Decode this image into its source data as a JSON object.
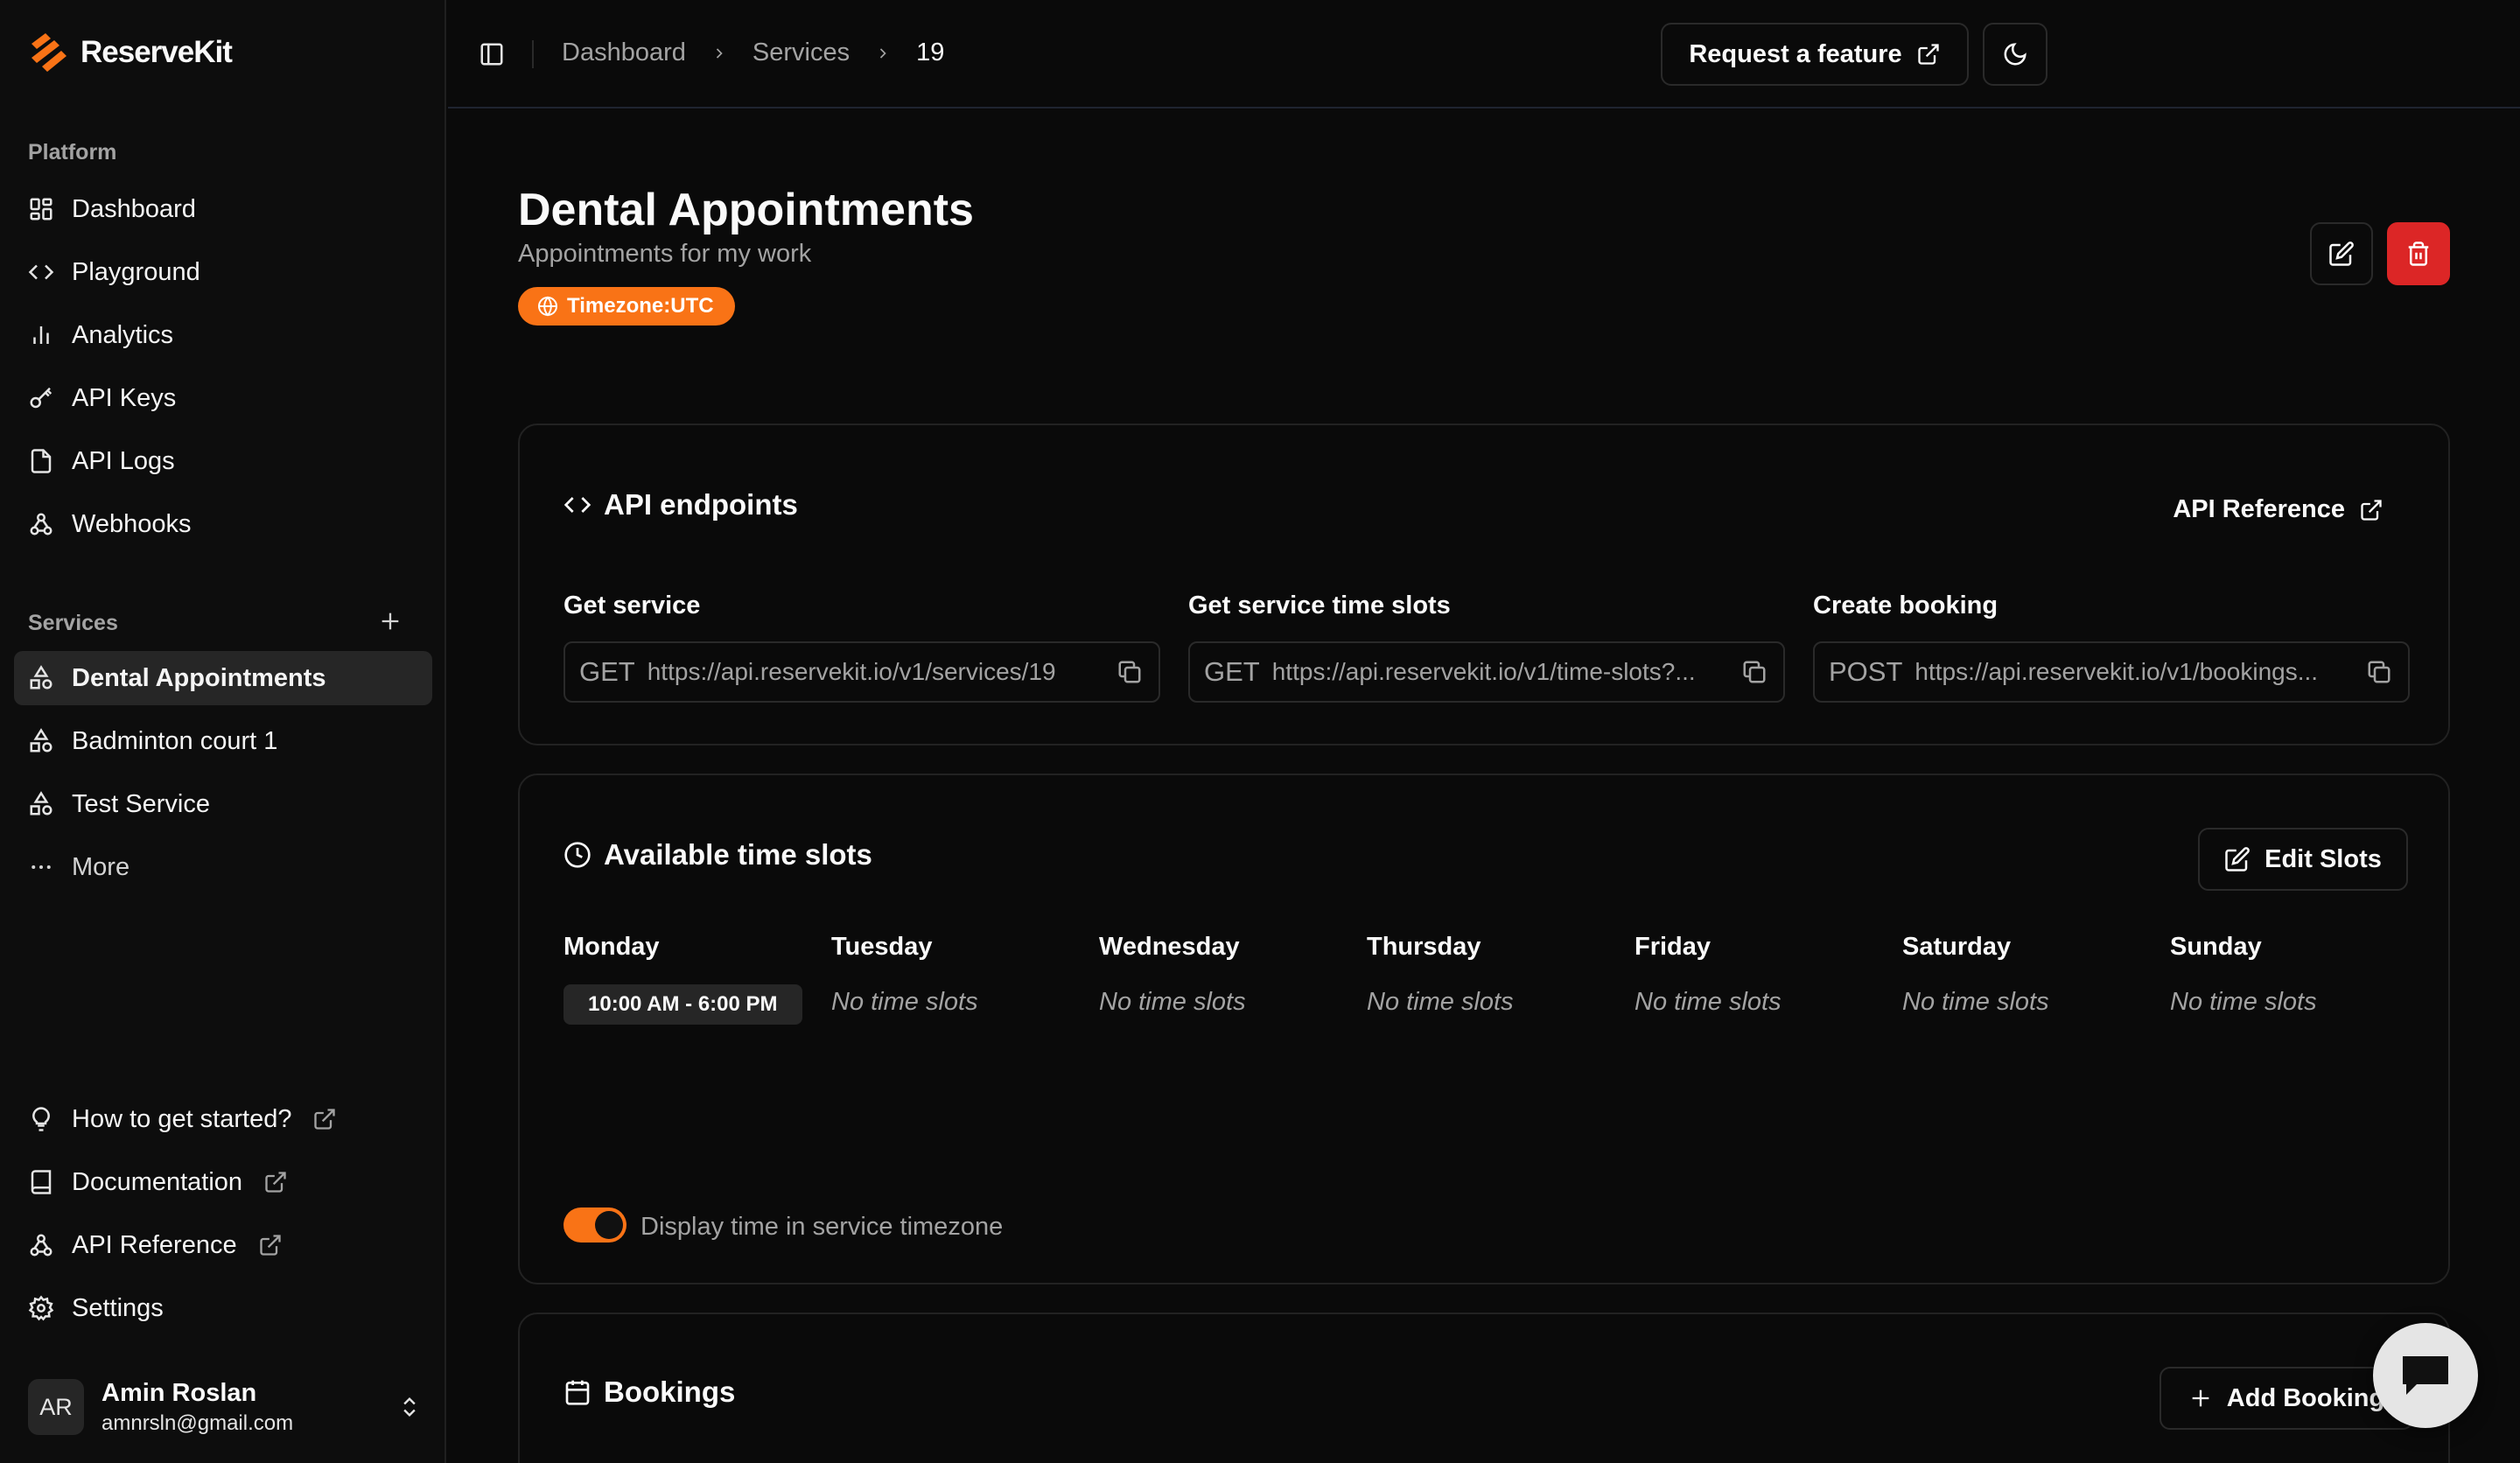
{
  "app": {
    "name": "ReserveKit",
    "accent": "#f97316",
    "danger": "#dc2626"
  },
  "sidebar": {
    "platform_label": "Platform",
    "platform_items": [
      {
        "label": "Dashboard",
        "icon": "dashboard-icon"
      },
      {
        "label": "Playground",
        "icon": "code-icon"
      },
      {
        "label": "Analytics",
        "icon": "bar-chart-icon"
      },
      {
        "label": "API Keys",
        "icon": "key-icon"
      },
      {
        "label": "API Logs",
        "icon": "file-icon"
      },
      {
        "label": "Webhooks",
        "icon": "webhook-icon"
      }
    ],
    "services_label": "Services",
    "service_items": [
      {
        "label": "Dental Appointments",
        "active": true
      },
      {
        "label": "Badminton court 1"
      },
      {
        "label": "Test Service"
      },
      {
        "label": "More"
      }
    ],
    "footer_items": [
      {
        "label": "How to get started?"
      },
      {
        "label": "Documentation"
      },
      {
        "label": "API Reference"
      },
      {
        "label": "Settings"
      }
    ],
    "user": {
      "initials": "AR",
      "name": "Amin Roslan",
      "email": "amnrsln@gmail.com"
    }
  },
  "header": {
    "breadcrumbs": [
      "Dashboard",
      "Services",
      "19"
    ],
    "request_feature_label": "Request a feature"
  },
  "service": {
    "title": "Dental Appointments",
    "subtitle": "Appointments for my work",
    "timezone_badge": "Timezone:UTC"
  },
  "api_card": {
    "title": "API endpoints",
    "reference_label": "API Reference",
    "endpoints": [
      {
        "label": "Get service",
        "method": "GET",
        "url": "https://api.reservekit.io/v1/services/19"
      },
      {
        "label": "Get service time slots",
        "method": "GET",
        "url": "https://api.reservekit.io/v1/time-slots?..."
      },
      {
        "label": "Create booking",
        "method": "POST",
        "url": "https://api.reservekit.io/v1/bookings..."
      }
    ]
  },
  "slots_card": {
    "title": "Available time slots",
    "edit_label": "Edit Slots",
    "days": [
      {
        "name": "Monday",
        "slot": "10:00 AM - 6:00 PM"
      },
      {
        "name": "Tuesday",
        "empty": "No time slots"
      },
      {
        "name": "Wednesday",
        "empty": "No time slots"
      },
      {
        "name": "Thursday",
        "empty": "No time slots"
      },
      {
        "name": "Friday",
        "empty": "No time slots"
      },
      {
        "name": "Saturday",
        "empty": "No time slots"
      },
      {
        "name": "Sunday",
        "empty": "No time slots"
      }
    ],
    "toggle_label": "Display time in service timezone",
    "toggle_on": true
  },
  "bookings_card": {
    "title": "Bookings",
    "add_label": "Add Booking"
  }
}
